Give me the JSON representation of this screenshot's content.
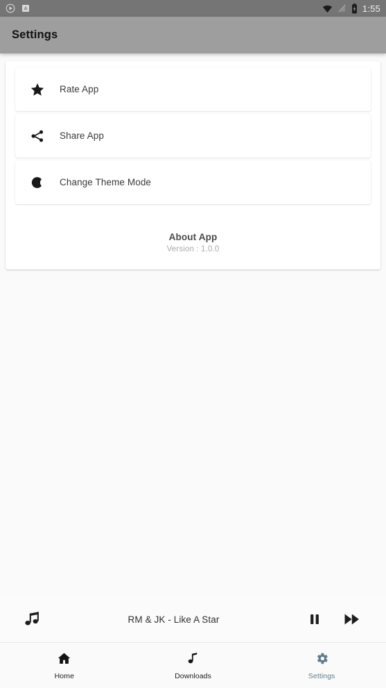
{
  "status_bar": {
    "left_icons": [
      "play-circle-icon",
      "a-badge-icon"
    ],
    "right_icons": [
      "wifi-icon",
      "signal-off-icon",
      "battery-icon"
    ],
    "time": "1:55",
    "background_color": "#757575"
  },
  "app_bar": {
    "title": "Settings",
    "background_color": "#9e9e9e"
  },
  "settings_list": {
    "items": [
      {
        "label": "Rate App",
        "icon": "star-icon"
      },
      {
        "label": "Share App",
        "icon": "share-icon"
      },
      {
        "label": "Change Theme Mode",
        "icon": "moon-icon"
      }
    ]
  },
  "about": {
    "title": "About App",
    "version": "Version : 1.0.0"
  },
  "mini_player": {
    "leading_icon": "music-notes-icon",
    "track_title": "RM & JK - Like A Star",
    "pause_button": "pause-icon",
    "next_button": "fast-forward-icon"
  },
  "bottom_nav": {
    "active_color": "#5f7d8c",
    "items": [
      {
        "label": "Home",
        "icon": "home-icon",
        "active": false
      },
      {
        "label": "Downloads",
        "icon": "music-note-icon",
        "active": false
      },
      {
        "label": "Settings",
        "icon": "gear-icon",
        "active": true
      }
    ]
  }
}
